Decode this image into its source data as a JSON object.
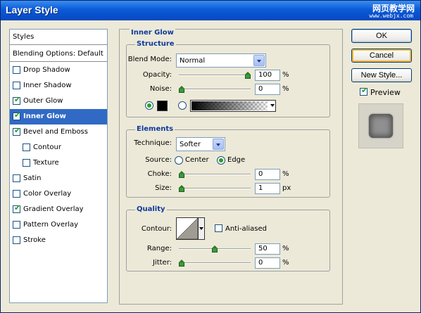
{
  "window": {
    "title": "Layer Style",
    "watermark_cn": "网页教学网",
    "watermark_url": "www.webjx.com"
  },
  "styles_list": {
    "header": "Styles",
    "blending": "Blending Options: Default",
    "items": [
      {
        "label": "Drop Shadow",
        "checked": false
      },
      {
        "label": "Inner Shadow",
        "checked": false
      },
      {
        "label": "Outer Glow",
        "checked": true
      },
      {
        "label": "Inner Glow",
        "checked": true,
        "selected": true
      },
      {
        "label": "Bevel and Emboss",
        "checked": true
      },
      {
        "label": "Contour",
        "checked": false,
        "indent": true
      },
      {
        "label": "Texture",
        "checked": false,
        "indent": true
      },
      {
        "label": "Satin",
        "checked": false
      },
      {
        "label": "Color Overlay",
        "checked": false
      },
      {
        "label": "Gradient Overlay",
        "checked": true
      },
      {
        "label": "Pattern Overlay",
        "checked": false
      },
      {
        "label": "Stroke",
        "checked": false
      }
    ]
  },
  "inner_glow": {
    "title": "Inner Glow",
    "structure": {
      "title": "Structure",
      "blend_mode_label": "Blend Mode:",
      "blend_mode_value": "Normal",
      "opacity_label": "Opacity:",
      "opacity_value": "100",
      "opacity_fraction": 1.0,
      "noise_label": "Noise:",
      "noise_value": "0",
      "noise_fraction": 0.0,
      "unit": "%",
      "glow_color": "#000000"
    },
    "elements": {
      "title": "Elements",
      "technique_label": "Technique:",
      "technique_value": "Softer",
      "source_label": "Source:",
      "source_center": "Center",
      "source_edge": "Edge",
      "source_selected": "Edge",
      "choke_label": "Choke:",
      "choke_value": "0",
      "choke_fraction": 0.0,
      "size_label": "Size:",
      "size_value": "1",
      "size_fraction": 0.0,
      "size_unit": "px"
    },
    "quality": {
      "title": "Quality",
      "contour_label": "Contour:",
      "anti_aliased_label": "Anti-aliased",
      "anti_aliased": false,
      "range_label": "Range:",
      "range_value": "50",
      "range_fraction": 0.5,
      "jitter_label": "Jitter:",
      "jitter_value": "0",
      "jitter_fraction": 0.0
    }
  },
  "buttons": {
    "ok": "OK",
    "cancel": "Cancel",
    "new_style": "New Style...",
    "preview_label": "Preview",
    "preview_checked": true
  },
  "colors": {
    "titlebar": "#0a5ad8",
    "selection": "#316ac5",
    "section_title": "#0e3a9b",
    "check": "#21a121"
  }
}
